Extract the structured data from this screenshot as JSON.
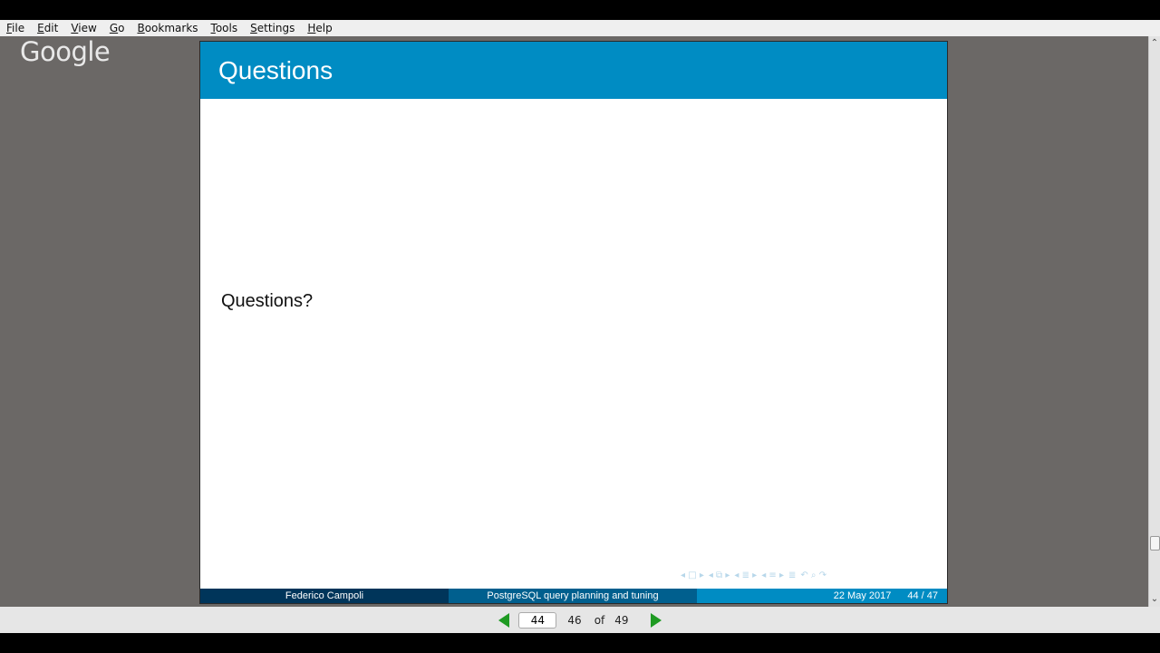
{
  "menubar": {
    "items": [
      {
        "mnemonic": "F",
        "rest": "ile"
      },
      {
        "mnemonic": "E",
        "rest": "dit"
      },
      {
        "mnemonic": "V",
        "rest": "iew"
      },
      {
        "mnemonic": "G",
        "rest": "o"
      },
      {
        "mnemonic": "B",
        "rest": "ookmarks"
      },
      {
        "mnemonic": "T",
        "rest": "ools"
      },
      {
        "mnemonic": "S",
        "rest": "ettings"
      },
      {
        "mnemonic": "H",
        "rest": "elp"
      }
    ]
  },
  "overlay": {
    "logo_text": "Google"
  },
  "slide": {
    "title": "Questions",
    "body_text": "Questions?",
    "footer": {
      "author": "Federico Campoli",
      "title": "PostgreSQL query planning and tuning",
      "date": "22 May 2017",
      "page": "44 / 47"
    }
  },
  "statusbar": {
    "page_input_value": "44",
    "current_page": "46",
    "of_label": "of",
    "total_pages": "49"
  },
  "colors": {
    "header_blue": "#008cc3",
    "footer_dark": "#00355a",
    "footer_mid": "#005f8e",
    "nav_arrow_green": "#1e9a22"
  }
}
